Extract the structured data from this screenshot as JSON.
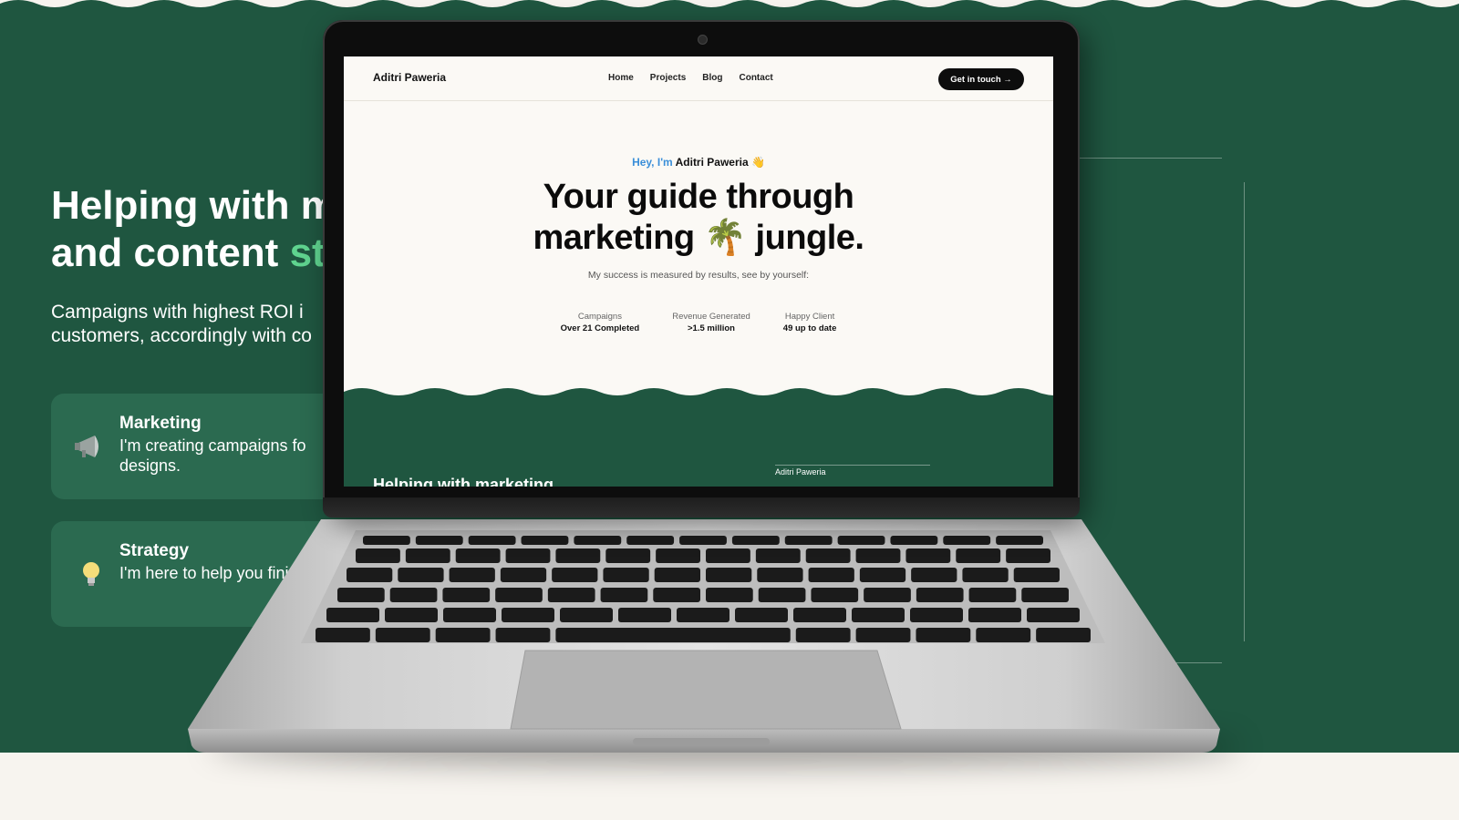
{
  "background": {
    "heading_line1": "Helping with m",
    "heading_line2_a": "and content ",
    "heading_line2_b": "st",
    "subtitle_line1": "Campaigns with highest ROI i",
    "subtitle_line2": "customers, accordingly with co",
    "cards": [
      {
        "title": "Marketing",
        "desc": "I'm creating campaigns fo designs.",
        "icon": "megaphone-icon"
      },
      {
        "title": "Strategy",
        "desc": "I'm here to help you finish.",
        "icon": "lightbulb-icon"
      }
    ]
  },
  "site": {
    "brand": "Aditri Paweria",
    "nav": [
      "Home",
      "Projects",
      "Blog",
      "Contact"
    ],
    "cta": "Get in touch →",
    "greeting_hey": "Hey, I'm",
    "greeting_name": " Aditri Paweria 👋",
    "hero_line1": "Your guide through",
    "hero_line2": "marketing 🌴 jungle.",
    "hero_sub": "My success is measured by results, see by yourself:",
    "stats": [
      {
        "label": "Campaigns",
        "value": "Over 21 Completed"
      },
      {
        "label": "Revenue Generated",
        "value": ">1.5 million"
      },
      {
        "label": "Happy Client",
        "value": "49 up to date"
      }
    ],
    "bottom_heading": "Helping with marketing",
    "bottom_name": "Aditri Paweria"
  },
  "colors": {
    "forest_green": "#1f5640",
    "accent_green": "#5fd38f",
    "hey_blue": "#3b8fd9",
    "cream": "#fbf9f5"
  }
}
